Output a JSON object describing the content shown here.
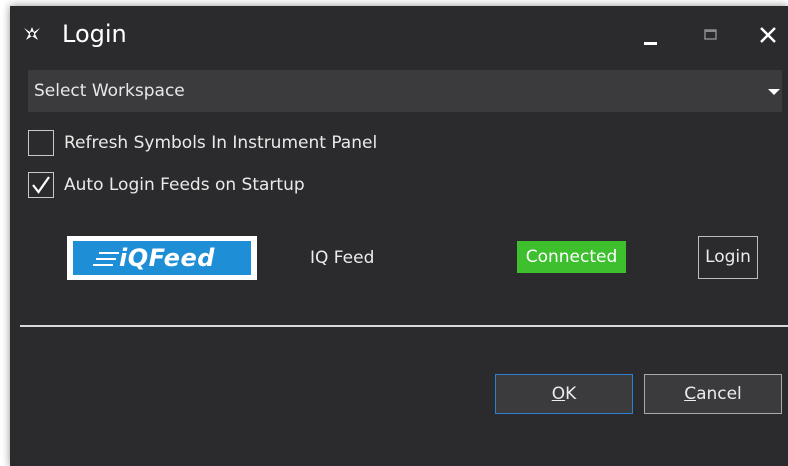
{
  "window": {
    "title": "Login",
    "controls": {
      "minimize_icon": "minimize-icon",
      "maximize_icon": "maximize-icon",
      "close_icon": "close-icon"
    }
  },
  "workspace": {
    "selected": "Select Workspace",
    "arrow_icon": "chevron-down-icon"
  },
  "options": [
    {
      "label": "Refresh Symbols In Instrument Panel",
      "checked": false
    },
    {
      "label": "Auto Login Feeds on Startup",
      "checked": true
    }
  ],
  "feeds": [
    {
      "logo_text": "iQFeed",
      "name": "IQ Feed",
      "status": "Connected",
      "status_color": "#3dbf2e",
      "login_label": "Login"
    }
  ],
  "buttons": {
    "ok_accel": "O",
    "ok_rest": "K",
    "cancel_accel": "C",
    "cancel_rest": "ancel"
  },
  "colors": {
    "background": "#2b2b2d",
    "field": "#3b3b3e",
    "accent": "#2f7fd0"
  }
}
